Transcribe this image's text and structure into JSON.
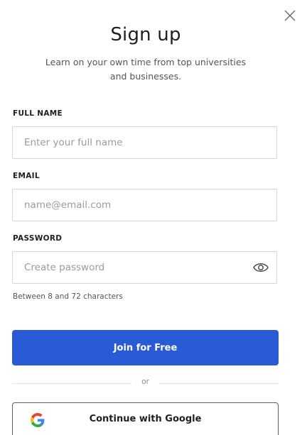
{
  "modal": {
    "title": "Sign up",
    "subtitle": "Learn on your own time from top universities and businesses."
  },
  "form": {
    "full_name": {
      "label": "FULL NAME",
      "placeholder": "Enter your full name",
      "value": ""
    },
    "email": {
      "label": "EMAIL",
      "placeholder": "name@email.com",
      "value": ""
    },
    "password": {
      "label": "PASSWORD",
      "placeholder": "Create password",
      "value": "",
      "hint": "Between 8 and 72 characters"
    }
  },
  "actions": {
    "join_label": "Join for Free",
    "divider_text": "or",
    "google_label": "Continue with Google"
  },
  "icons": {
    "close": "close-icon",
    "eye": "eye-icon",
    "google": "google-logo-icon"
  },
  "colors": {
    "primary": "#2a5bd7",
    "google_blue": "#4285F4",
    "google_red": "#EA4335",
    "google_yellow": "#FBBC05",
    "google_green": "#34A853"
  }
}
